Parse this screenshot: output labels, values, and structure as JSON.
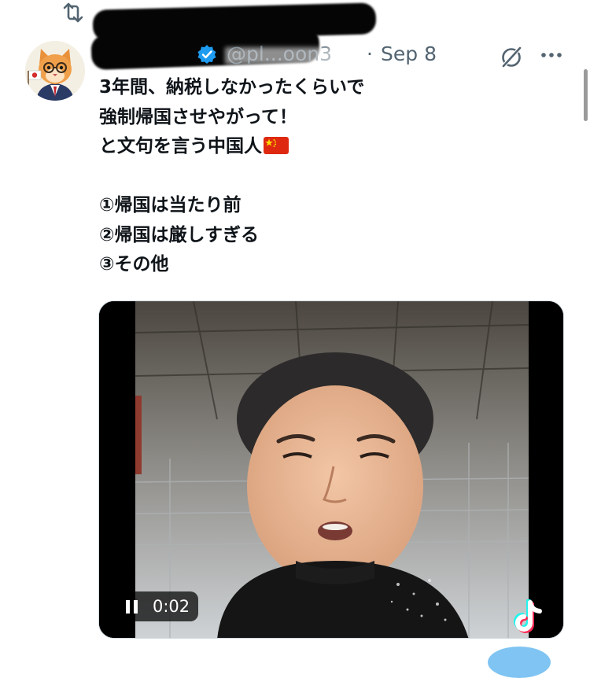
{
  "repost": {
    "label_suffix": "reposted",
    "icon": "repost-icon"
  },
  "post": {
    "handle": "@pl...oon3",
    "separator": "·",
    "date": "Sep 8",
    "lines": [
      "3年間、納税しなかったくらいで",
      "強制帰国させやがって！",
      "と文句を言う中国人",
      "",
      "①帰国は当たり前",
      "②帰国は厳しすぎる",
      "③その他"
    ],
    "flag_icon": "china-flag-icon"
  },
  "video": {
    "time": "0:02",
    "state": "playing",
    "watermark_icon": "tiktok-icon"
  },
  "colors": {
    "text": "#0f1419",
    "muted": "#536471",
    "verified": "#1d9bf0",
    "flag_red": "#de2910",
    "flag_yellow": "#ffde00"
  }
}
